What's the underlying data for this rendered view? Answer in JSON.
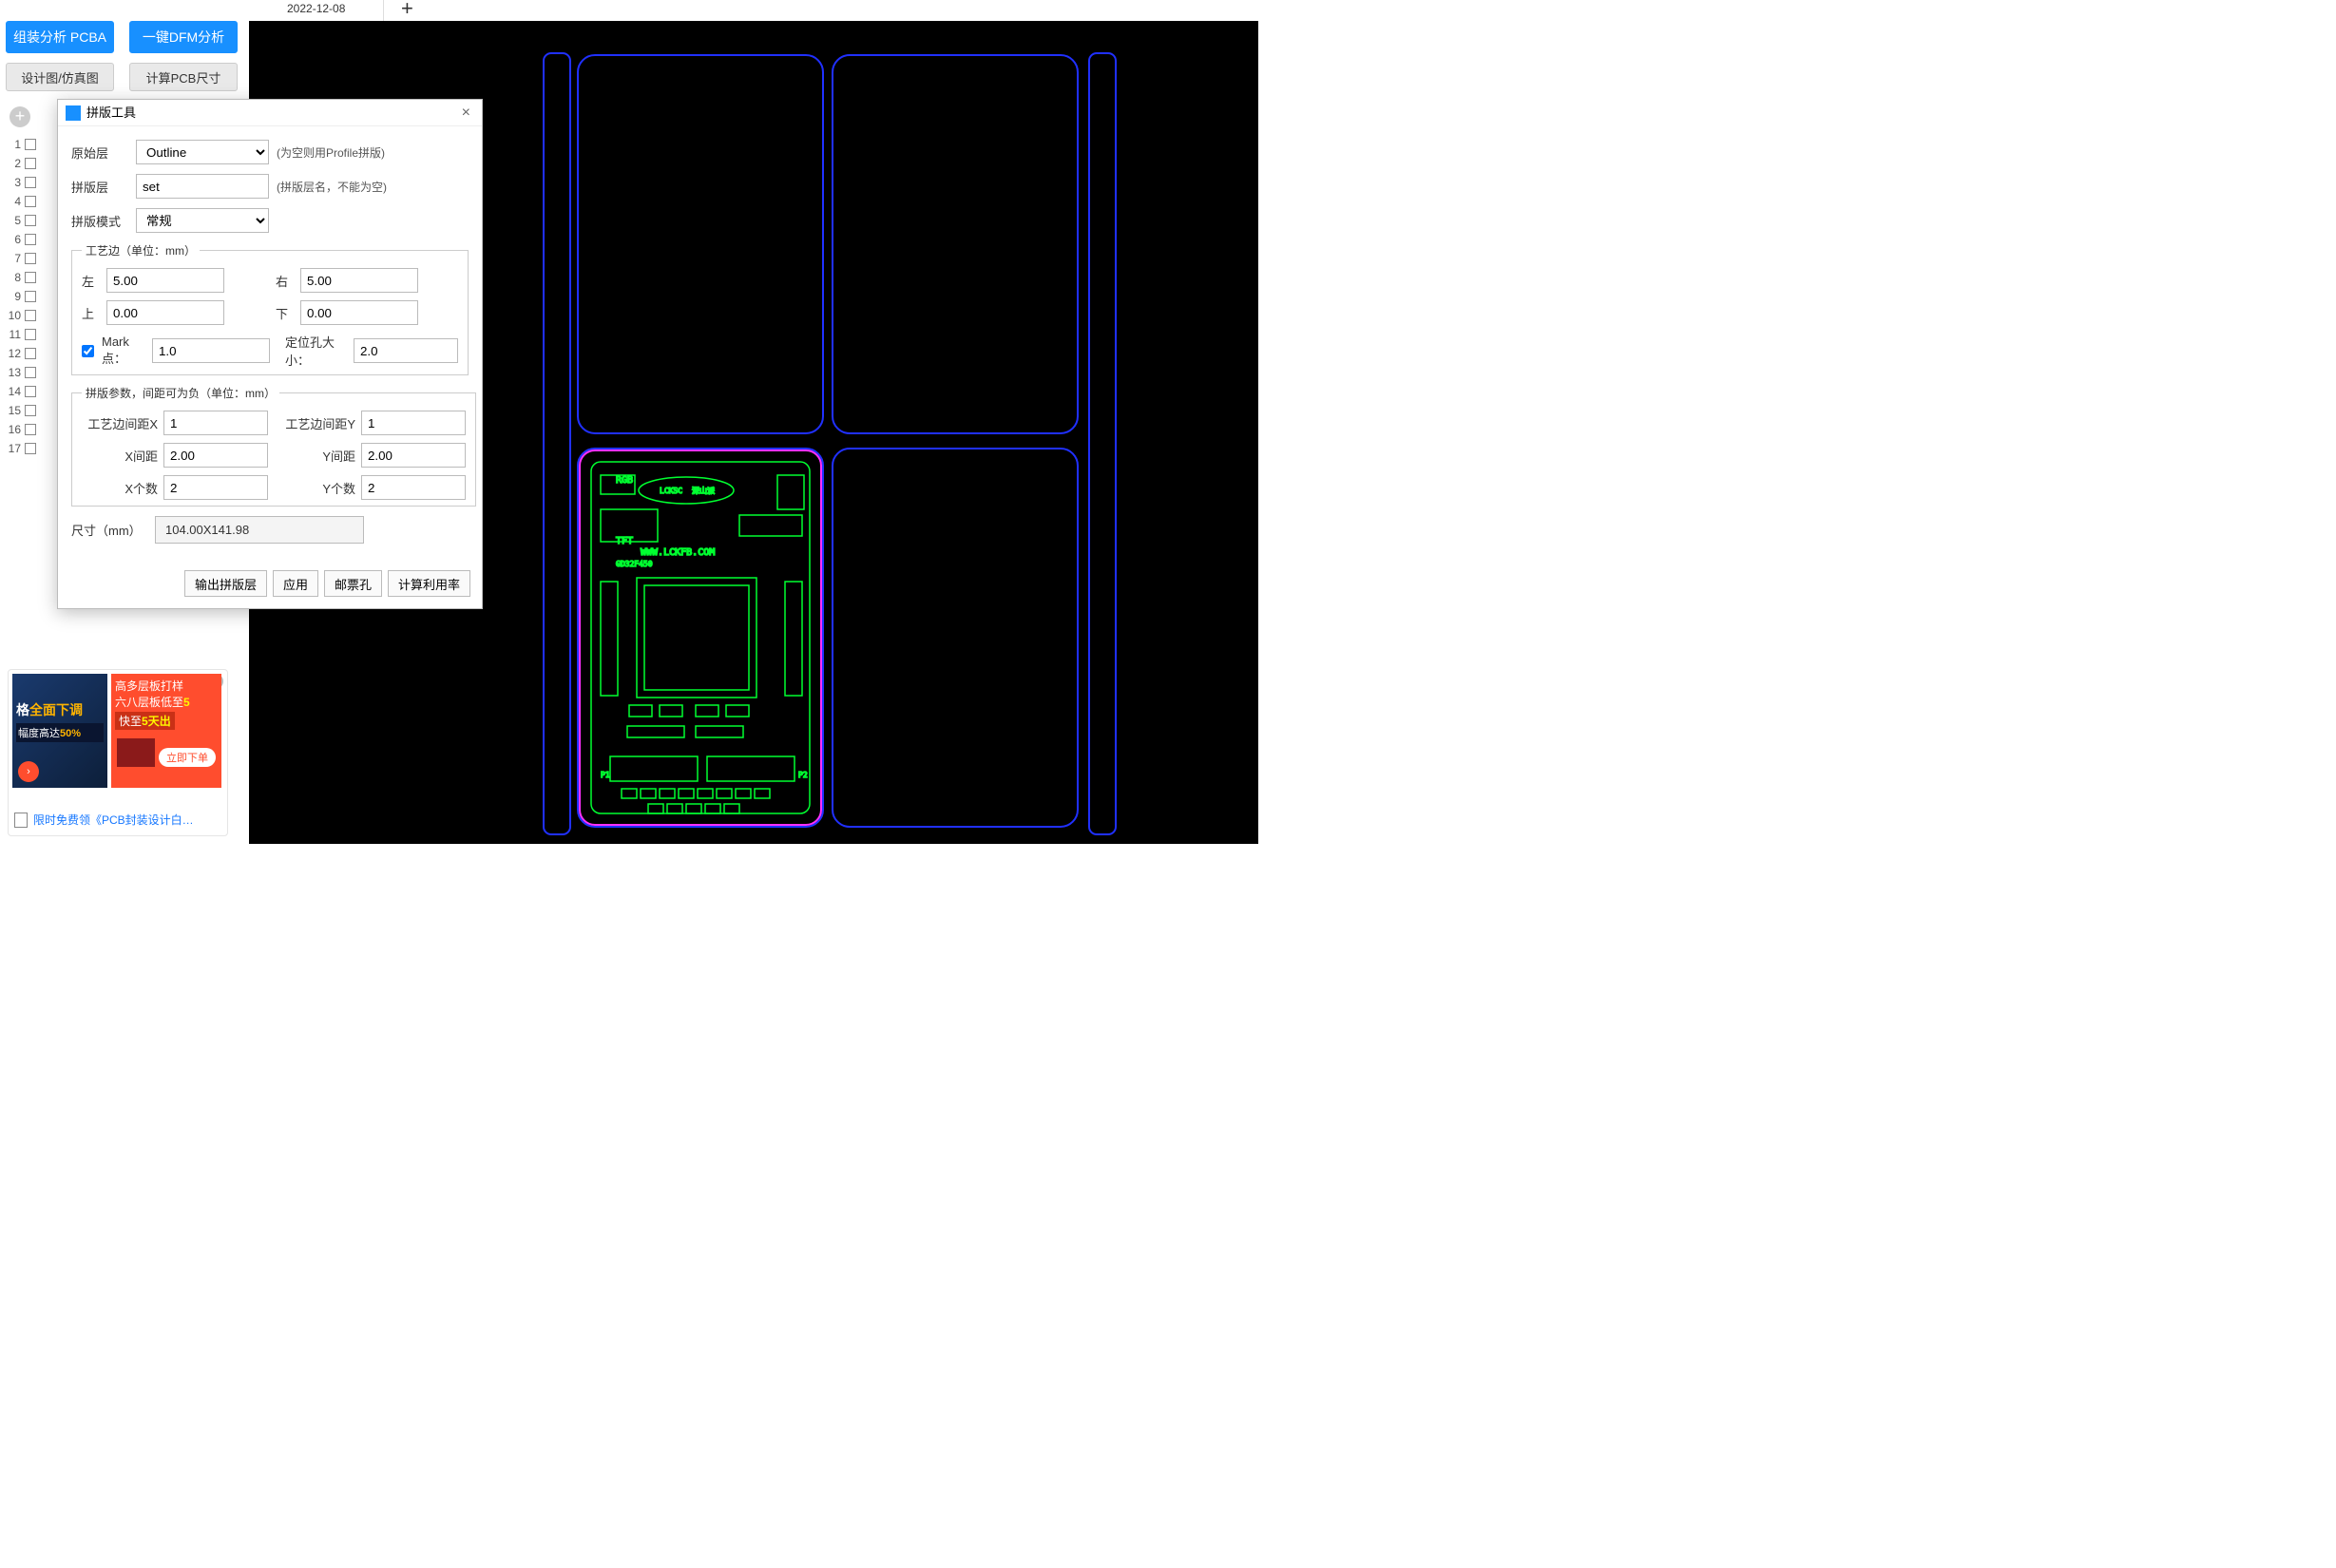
{
  "toolbar": {
    "assembly_pcba": "组装分析 PCBA",
    "dfm": "一键DFM分析",
    "design_sim": "设计图/仿真图",
    "calc_size": "计算PCB尺寸"
  },
  "tab": {
    "active_date": "2022-12-08"
  },
  "gutter_rows": [
    "1",
    "2",
    "3",
    "4",
    "5",
    "6",
    "7",
    "8",
    "9",
    "10",
    "11",
    "12",
    "13",
    "14",
    "15",
    "16",
    "17"
  ],
  "ads": {
    "left_line1": "全面下调",
    "left_line2_prefix": "幅度高达",
    "left_line2_em": "50%",
    "right_l1": "高多层板打样",
    "right_l2_pre": "六八层板低至",
    "right_l2_em": "5",
    "right_l3_pre": "快至",
    "right_l3_em": "5天出",
    "right_btn": "立即下单",
    "foot": "限时免费领《PCB封装设计白…"
  },
  "dialog": {
    "title": "拼版工具",
    "src_layer_label": "原始层",
    "src_layer_value": "Outline",
    "src_layer_hint": "(为空则用Profile拼版)",
    "panel_layer_label": "拼版层",
    "panel_layer_value": "set",
    "panel_layer_hint": "(拼版层名，不能为空)",
    "mode_label": "拼版模式",
    "mode_value": "常规",
    "rail_legend": "工艺边（单位：mm）",
    "left_label": "左",
    "left_value": "5.00",
    "right_label": "右",
    "right_value": "5.00",
    "top_label": "上",
    "top_value": "0.00",
    "bottom_label": "下",
    "bottom_value": "0.00",
    "mark_label": "Mark点：",
    "mark_value": "1.0",
    "hole_label": "定位孔大小：",
    "hole_value": "2.0",
    "param_legend": "拼版参数，间距可为负（单位：mm）",
    "rail_gap_x_label": "工艺边间距X",
    "rail_gap_x_value": "1",
    "rail_gap_y_label": "工艺边间距Y",
    "rail_gap_y_value": "1",
    "gap_x_label": "X间距",
    "gap_x_value": "2.00",
    "gap_y_label": "Y间距",
    "gap_y_value": "2.00",
    "count_x_label": "X个数",
    "count_x_value": "2",
    "count_y_label": "Y个数",
    "count_y_value": "2",
    "dim_label": "尺寸（mm）",
    "dim_value": "104.00X141.98",
    "btn_output": "输出拼版层",
    "btn_apply": "应用",
    "btn_stamp": "邮票孔",
    "btn_util": "计算利用率"
  },
  "pcb": {
    "rgb": "RGB",
    "tft": "TFT",
    "url": "WWW.LCKFB.COM",
    "mcu": "GD32F450",
    "p1": "P1",
    "p2": "P2",
    "logo": "LCKSC",
    "logo2": "深山派"
  }
}
